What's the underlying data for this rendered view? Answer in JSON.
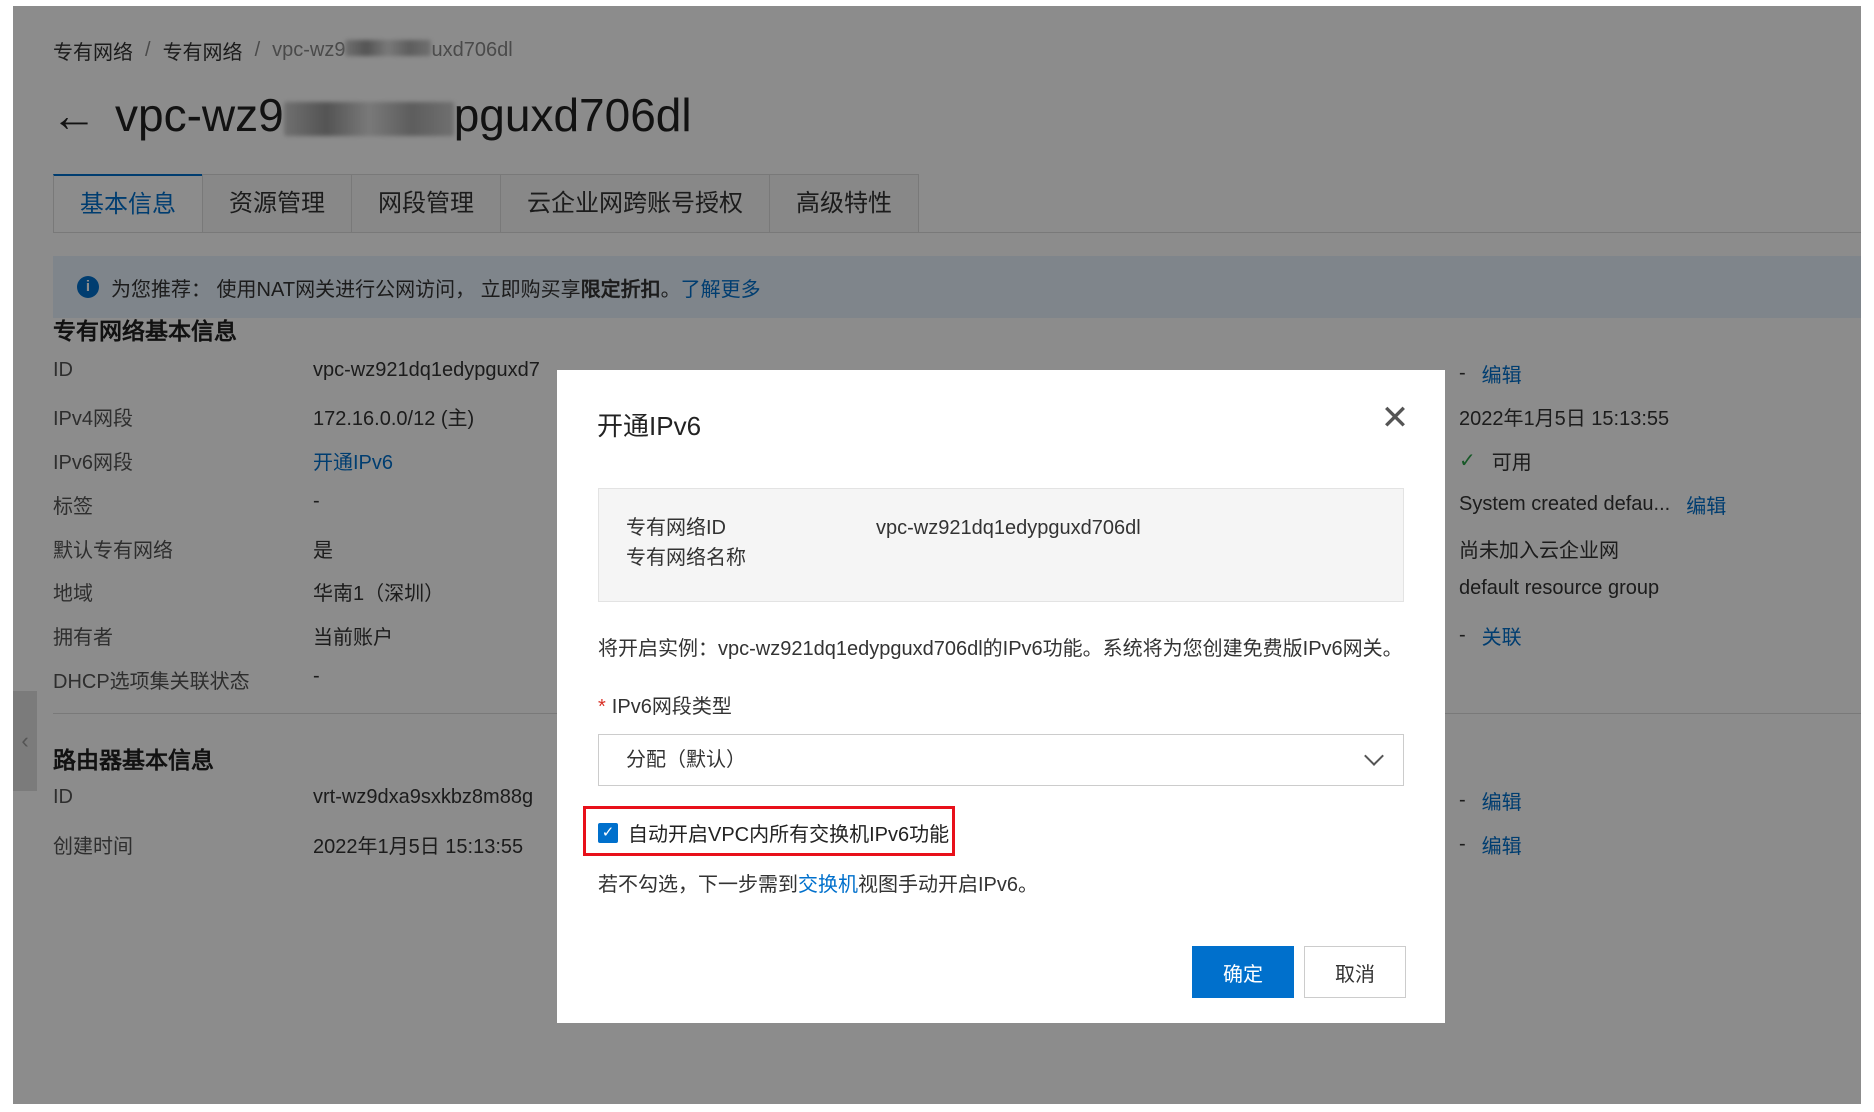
{
  "breadcrumb": {
    "item1": "专有网络",
    "item2": "专有网络",
    "current_prefix": "vpc-wz9",
    "current_suffix": "uxd706dl",
    "separator": "/"
  },
  "page_title": {
    "prefix": "vpc-wz9",
    "suffix": "pguxd706dl"
  },
  "tabs": [
    "基本信息",
    "资源管理",
    "网段管理",
    "云企业网跨账号授权",
    "高级特性"
  ],
  "notice": {
    "text": "为您推荐：  使用NAT网关进行公网访问，  立即购买享",
    "bold": "限定折扣",
    "period": "。",
    "link": "了解更多"
  },
  "vpc_section": {
    "title": "专有网络基本信息",
    "rows": [
      {
        "label": "ID",
        "value": "vpc-wz921dq1edypguxd7"
      },
      {
        "label": "IPv4网段",
        "value": "172.16.0.0/12 (主)"
      },
      {
        "label": "IPv6网段",
        "value": "开通IPv6"
      },
      {
        "label": "标签",
        "value": "-"
      },
      {
        "label": "默认专有网络",
        "value": "是"
      },
      {
        "label": "地域",
        "value": "华南1（深圳）"
      },
      {
        "label": "拥有者",
        "value": "当前账户"
      },
      {
        "label": "DHCP选项集关联状态",
        "value": "-"
      }
    ],
    "right": {
      "name_dash": "-",
      "name_edit": "编辑",
      "created": "2022年1月5日 15:13:55",
      "status": "可用",
      "desc": "System created defau...",
      "desc_edit": "编辑",
      "cen": "尚未加入云企业网",
      "rg": "default resource group",
      "assoc_dash": "-",
      "assoc_link": "关联"
    }
  },
  "router_section": {
    "title": "路由器基本信息",
    "rows": [
      {
        "label": "ID",
        "value": "vrt-wz9dxa9sxkbz8m88g"
      },
      {
        "label": "创建时间",
        "value": "2022年1月5日 15:13:55"
      }
    ],
    "right": {
      "dash1": "-",
      "edit1": "编辑",
      "dash2": "-",
      "edit2": "编辑"
    }
  },
  "modal": {
    "title": "开通IPv6",
    "info": {
      "vpc_id_label": "专有网络ID",
      "vpc_id_value": "vpc-wz921dq1edypguxd706dl",
      "vpc_name_label": "专有网络名称",
      "vpc_name_value": ""
    },
    "description": "将开启实例：vpc-wz921dq1edypguxd706dl的IPv6功能。系统将为您创建免费版IPv6网关。",
    "field_label": "IPv6网段类型",
    "required_mark": "*",
    "select_value": "分配（默认）",
    "checkbox_label": "自动开启VPC内所有交换机IPv6功能",
    "checkbox_checked": true,
    "hint_prefix": "若不勾选，下一步需到",
    "hint_link": "交换机",
    "hint_suffix": "视图手动开启IPv6。",
    "ok_label": "确定",
    "cancel_label": "取消"
  },
  "colors": {
    "accent": "#0070cc",
    "highlight": "#e8101a",
    "status_ok": "#2aa148"
  },
  "icons": {
    "back": "arrow-left-icon",
    "info": "info-circle-icon",
    "close": "close-icon",
    "chevron": "chevron-down-icon",
    "check": "check-icon"
  }
}
